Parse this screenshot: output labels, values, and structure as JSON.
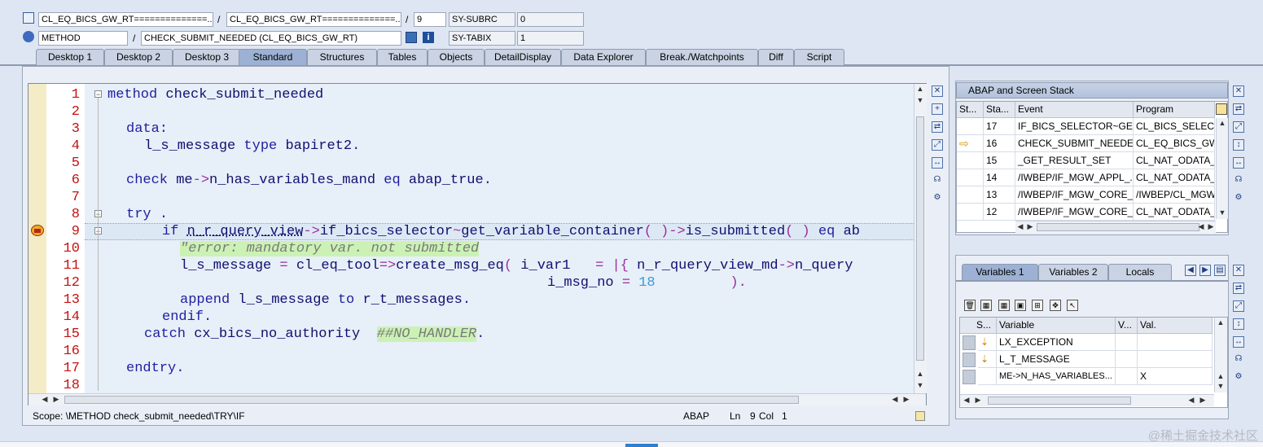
{
  "header": {
    "row1": {
      "field1": "CL_EQ_BICS_GW_RT==============...",
      "sep1": "/",
      "field2": "CL_EQ_BICS_GW_RT==============...",
      "sep2": "/",
      "line": "9",
      "sysfield": "SY-SUBRC",
      "sysvalue": "0"
    },
    "row2": {
      "type": "METHOD",
      "sep": "/",
      "name": "CHECK_SUBMIT_NEEDED (CL_EQ_BICS_GW_RT)",
      "sysfield": "SY-TABIX",
      "sysvalue": "1"
    }
  },
  "tabs": [
    "Desktop 1",
    "Desktop 2",
    "Desktop 3",
    "Standard",
    "Structures",
    "Tables",
    "Objects",
    "DetailDisplay",
    "Data Explorer",
    "Break./Watchpoints",
    "Diff",
    "Script"
  ],
  "active_tab": "Standard",
  "editor": {
    "line_numbers": [
      "1",
      "2",
      "3",
      "4",
      "5",
      "6",
      "7",
      "8",
      "9",
      "10",
      "11",
      "12",
      "13",
      "14",
      "15",
      "16",
      "17",
      "18"
    ],
    "l1a": "method ",
    "l1b": "check_submit_needed",
    ".": ".",
    "l3": "data:",
    "l4a": "l_s_message ",
    "l4b": "type ",
    "l4c": "bapiret2",
    "l6a": "check ",
    "l6b": "me",
    "l6c": "->",
    "l6d": "n_has_variables_mand ",
    "l6e": "eq ",
    "l6f": "abap_true",
    "l8a": "try ",
    "l9a": "if ",
    "l9b": "n_r_query_view",
    "l9c": "->",
    "l9d": "if_bics_selector",
    "l9e": "~",
    "l9f": "get_variable_container",
    "l9g": "( )",
    "l9h": "->",
    "l9i": "is_submitted",
    "l9j": "( ) ",
    "l9k": "eq ",
    "l9l": "ab",
    "l10": "\"error: mandatory var. not submitted",
    "l11a": "l_s_message ",
    "l11b": "= ",
    "l11c": "cl_eq_tool",
    "l11d": "=>",
    "l11e": "create_msg_eq",
    "l11f": "( ",
    "l11g": "i_var1   ",
    "l11h": "= |{ ",
    "l11i": "n_r_query_view_md",
    "l11j": "->",
    "l11k": "n_query",
    "l12a": "i_msg_no ",
    "l12b": "= ",
    "l12c": "18",
    "l12d": "         ).",
    "l13a": "append ",
    "l13b": "l_s_message ",
    "l13c": "to ",
    "l13d": "r_t_messages",
    "l14": "endif",
    "l15a": "catch ",
    "l15b": "cx_bics_no_authority",
    "l15c": "##NO_HANDLER",
    "l17": "endtry"
  },
  "stack_panel": {
    "title": "ABAP and Screen Stack",
    "columns": [
      "St...",
      "Sta...",
      "Event",
      "Program"
    ],
    "rows": [
      {
        "st": "",
        "level": "17",
        "event": "IF_BICS_SELECTOR~GE...",
        "program": "CL_BICS_SELECTO"
      },
      {
        "st": "current",
        "level": "16",
        "event": "CHECK_SUBMIT_NEEDED",
        "program": "CL_EQ_BICS_GW_"
      },
      {
        "st": "",
        "level": "15",
        "event": "_GET_RESULT_SET",
        "program": "CL_NAT_ODATA_"
      },
      {
        "st": "",
        "level": "14",
        "event": "/IWBEP/IF_MGW_APPL_...",
        "program": "CL_NAT_ODATA_"
      },
      {
        "st": "",
        "level": "13",
        "event": "/IWBEP/IF_MGW_CORE_...",
        "program": "/IWBEP/CL_MGW_"
      },
      {
        "st": "",
        "level": "12",
        "event": "/IWBEP/IF_MGW_CORE_...",
        "program": "CL_NAT_ODATA_"
      }
    ]
  },
  "variables_panel": {
    "tabs": [
      "Variables 1",
      "Variables 2",
      "Locals"
    ],
    "active_tab": "Variables 1",
    "columns": [
      "S...",
      "Variable",
      "V...",
      "Val."
    ],
    "rows": [
      {
        "variable": "LX_EXCEPTION",
        "value": ""
      },
      {
        "variable": "L_T_MESSAGE",
        "value": ""
      },
      {
        "variable": "ME->N_HAS_VARIABLES...",
        "value": "X"
      }
    ]
  },
  "status_bar": {
    "scope": "Scope: \\METHOD check_submit_needed\\TRY\\IF",
    "lang": "ABAP",
    "ln_label": "Ln",
    "ln": "9",
    "col_label": "Col",
    "col": "1"
  },
  "watermark": "@稀土掘金技术社区"
}
